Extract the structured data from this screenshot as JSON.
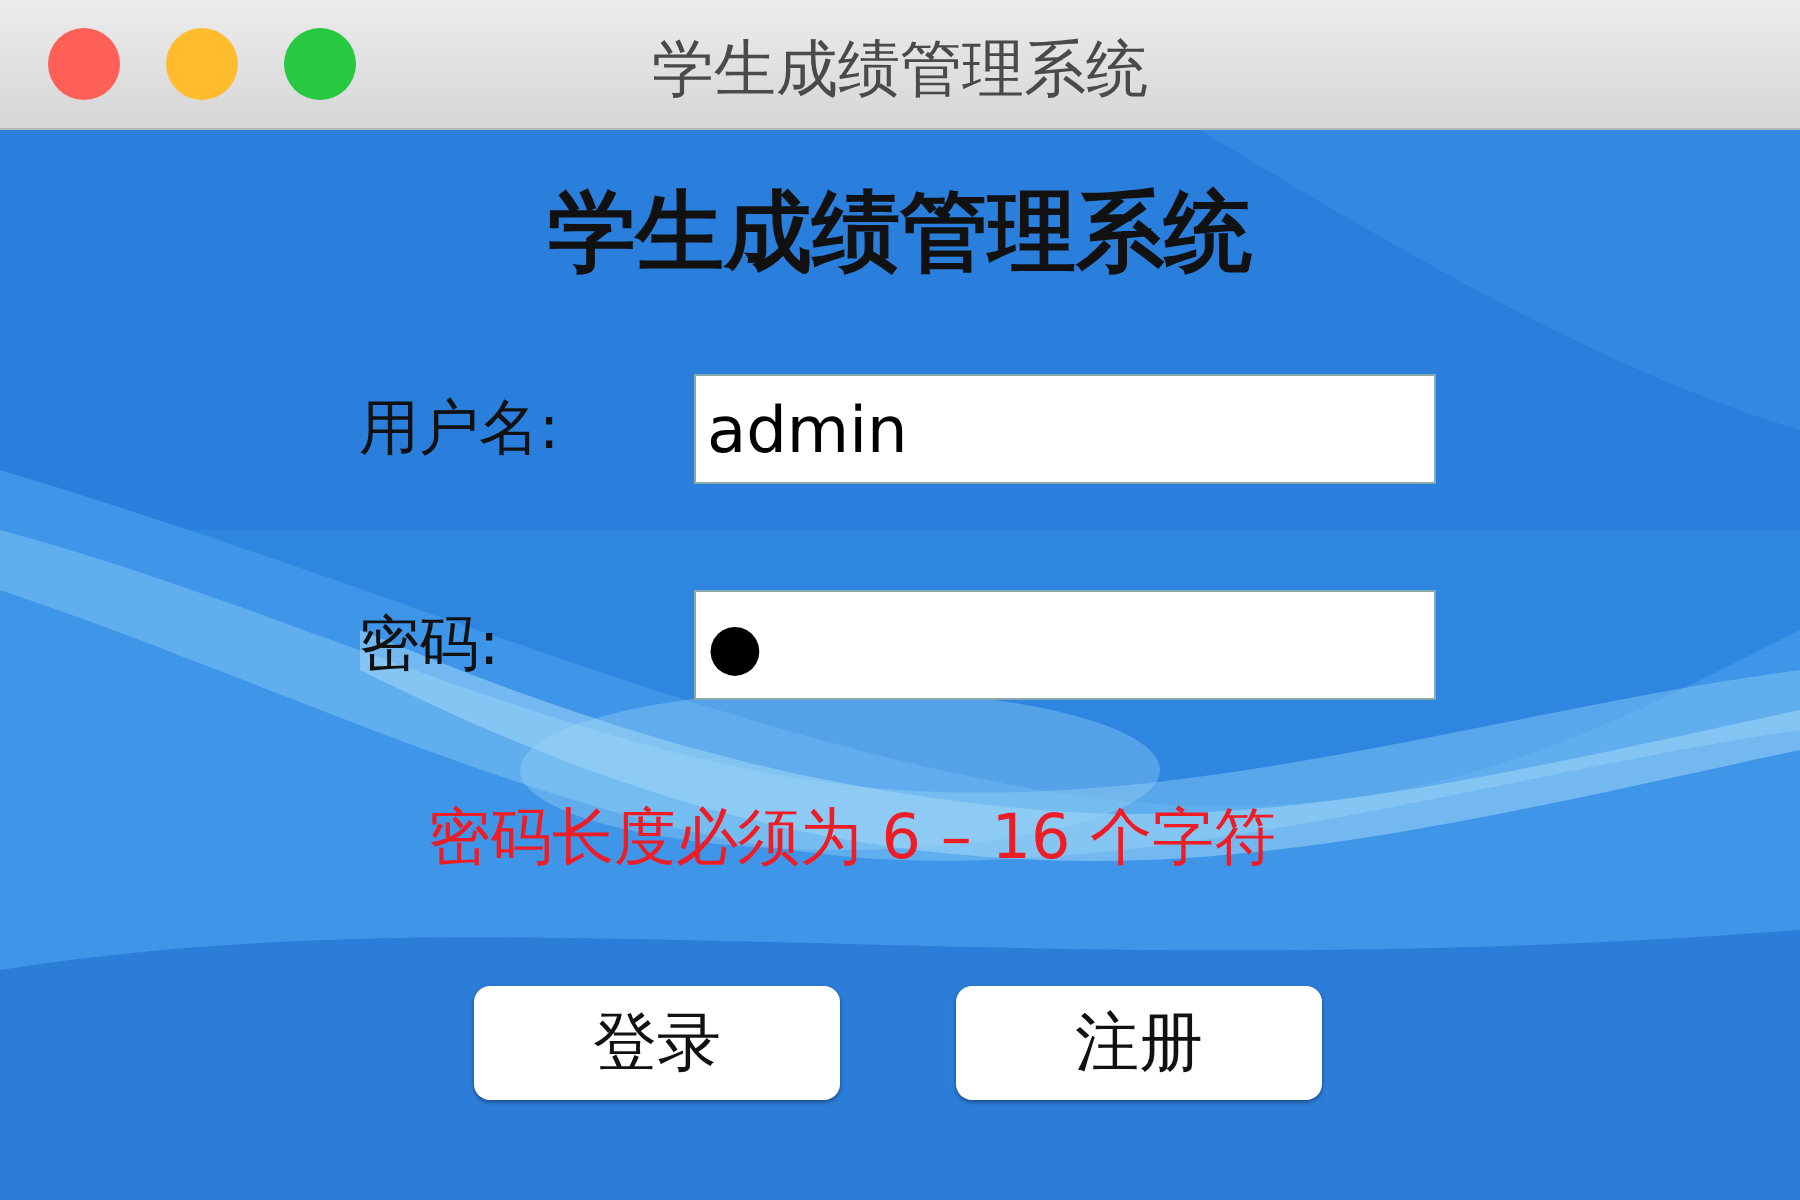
{
  "window": {
    "title": "学生成绩管理系统"
  },
  "heading": "学生成绩管理系统",
  "fields": [
    {
      "label": "用户名:",
      "value": "admin"
    },
    {
      "label": "密码:",
      "value": "●"
    }
  ],
  "error": "密码长度必须为 6 – 16 个字符",
  "buttons": [
    "登录",
    "注册"
  ]
}
